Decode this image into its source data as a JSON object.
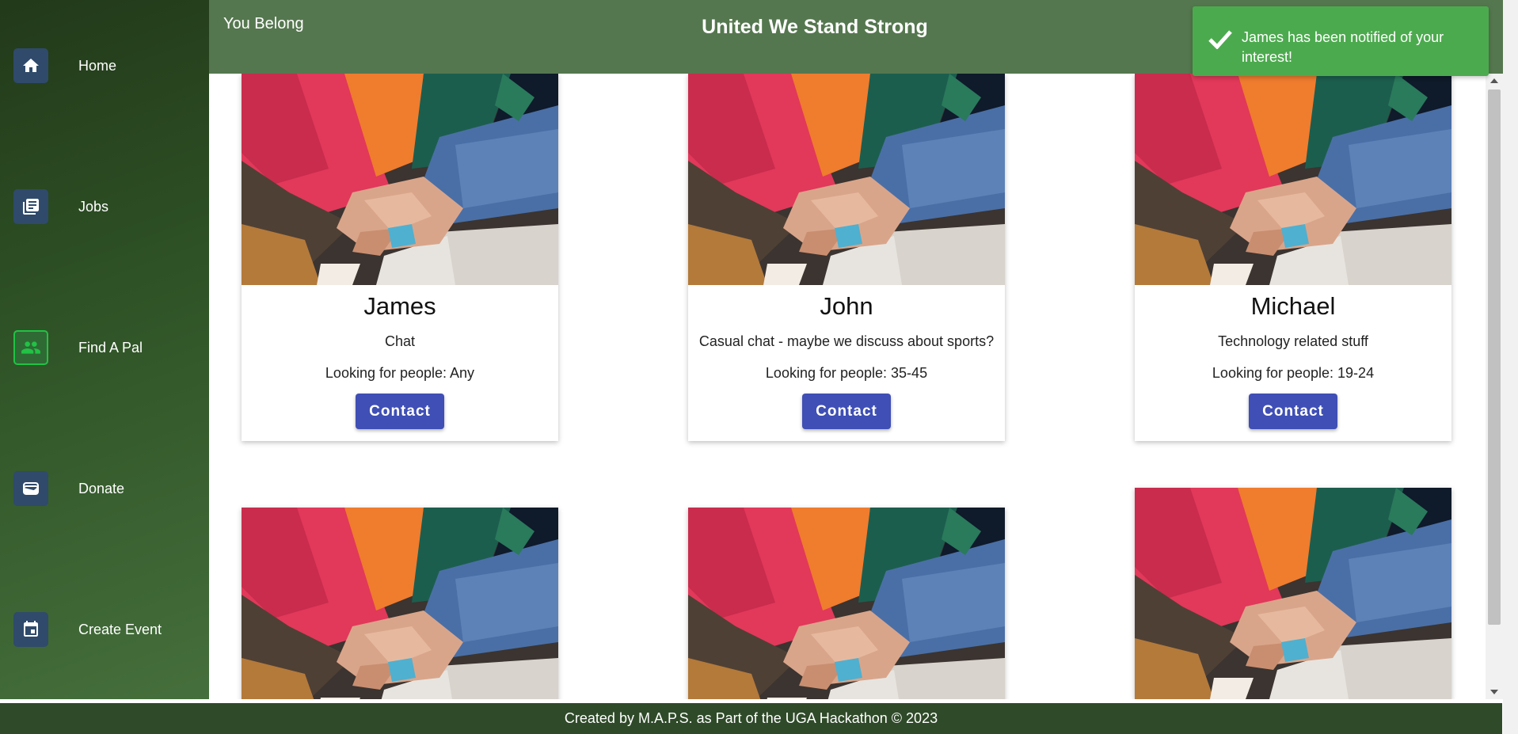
{
  "sidebar": {
    "items": [
      {
        "label": "Home",
        "icon": "home-icon"
      },
      {
        "label": "Jobs",
        "icon": "jobs-icon"
      },
      {
        "label": "Find A Pal",
        "icon": "people-icon"
      },
      {
        "label": "Donate",
        "icon": "wallet-icon"
      },
      {
        "label": "Create Event",
        "icon": "calendar-icon"
      }
    ]
  },
  "header": {
    "brand": "You Belong",
    "title": "United We Stand Strong"
  },
  "toast": {
    "message": "James has been notified of your interest!"
  },
  "cards": [
    {
      "name": "James",
      "description": "Chat",
      "age": "Looking for people: Any",
      "button": "Contact"
    },
    {
      "name": "John",
      "description": "Casual chat - maybe we discuss about sports?",
      "age": "Looking for people: 35-45",
      "button": "Contact"
    },
    {
      "name": "Michael",
      "description": "Technology related stuff",
      "age": "Looking for people: 19-24",
      "button": "Contact"
    }
  ],
  "footer": {
    "text": "Created by M.A.P.S. as Part of the UGA Hackathon © 2023"
  },
  "colors": {
    "sidebar_dark": "#22391a",
    "header": "#55774f",
    "toast": "#4caa4e",
    "button": "#3f4fb5",
    "footer": "#2f4a29"
  }
}
